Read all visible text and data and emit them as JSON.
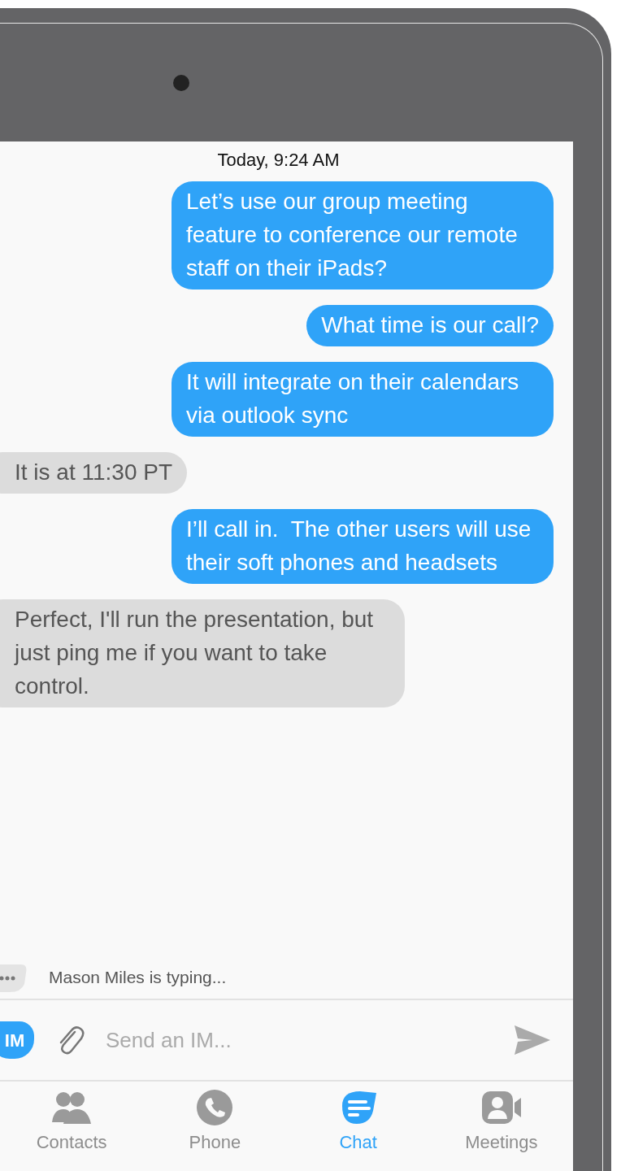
{
  "timestamp": "Today, 9:24 AM",
  "messages": [
    {
      "kind": "sent",
      "text": "Let’s use our group meeting feature to conference our remote staff on their iPads?"
    },
    {
      "kind": "sent",
      "text": "What time is our call?"
    },
    {
      "kind": "sent",
      "text": "It will integrate on their calendars via outlook sync"
    },
    {
      "kind": "received",
      "text": "It is at 11:30 PT"
    },
    {
      "kind": "sent",
      "text": "I’ll call in.  The other users will use their soft phones and headsets"
    },
    {
      "kind": "received",
      "text": "Perfect, I'll run the presentation, but just ping me if you want to take control."
    }
  ],
  "typing_indicator": "Mason Miles is typing...",
  "composer": {
    "badge": "IM",
    "placeholder": "Send an IM..."
  },
  "tabs": [
    {
      "label": "Contacts",
      "selected": false
    },
    {
      "label": "Phone",
      "selected": false
    },
    {
      "label": "Chat",
      "selected": true
    },
    {
      "label": "Meetings",
      "selected": false
    }
  ]
}
